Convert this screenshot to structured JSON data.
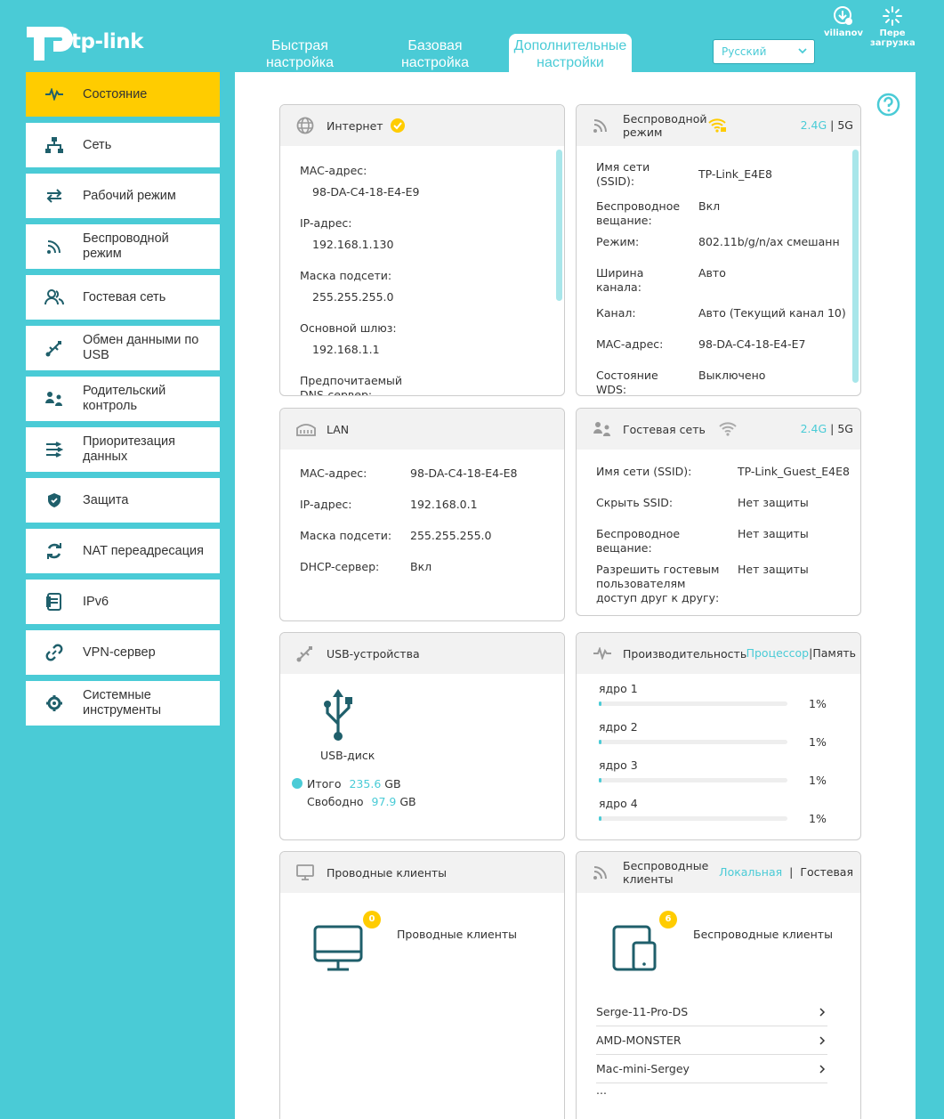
{
  "brand": {
    "name": "tp-link"
  },
  "top_tabs": [
    {
      "label": "Быстрая настройка"
    },
    {
      "label": "Базовая настройка"
    },
    {
      "label": "Дополнительные настройки"
    }
  ],
  "language": {
    "selected": "Русский"
  },
  "user": {
    "name": "vilianov"
  },
  "reboot": {
    "label": "Пере загрузка"
  },
  "sidebar": {
    "items": [
      {
        "label": "Состояние",
        "icon": "pulse-icon"
      },
      {
        "label": "Сеть",
        "icon": "network-icon"
      },
      {
        "label": "Рабочий режим",
        "icon": "mode-icon"
      },
      {
        "label": "Беспроводной режим",
        "icon": "wireless-icon"
      },
      {
        "label": "Гостевая сеть",
        "icon": "guest-icon"
      },
      {
        "label": "Обмен данными по USB",
        "icon": "usb-icon"
      },
      {
        "label": "Родительский контроль",
        "icon": "parental-icon"
      },
      {
        "label": "Приоритезация данных",
        "icon": "qos-icon"
      },
      {
        "label": "Защита",
        "icon": "shield-icon"
      },
      {
        "label": "NAT переадресация",
        "icon": "nat-icon"
      },
      {
        "label": "IPv6",
        "icon": "ipv6-icon"
      },
      {
        "label": "VPN-сервер",
        "icon": "link-icon"
      },
      {
        "label": "Системные инструменты",
        "icon": "gear-icon"
      }
    ]
  },
  "internet": {
    "title": "Интернет",
    "mac_label": "MAC-адрес:",
    "mac": "98-DA-C4-18-E4-E9",
    "ip_label": "IP-адрес:",
    "ip": "192.168.1.130",
    "mask_label": "Маска подсети:",
    "mask": "255.255.255.0",
    "gw_label": "Основной шлюз:",
    "gw": "192.168.1.1",
    "dns_label": "Предпочитаемый DNS-сервер:"
  },
  "wireless": {
    "title": "Беспроводной режим",
    "band_24": "2.4G",
    "band_sep": "|",
    "band_5": "5G",
    "ssid_label": "Имя сети (SSID):",
    "ssid": "TP-Link_E4E8",
    "broadcast_label": "Беспроводное вещание:",
    "broadcast": "Вкл",
    "mode_label": "Режим:",
    "mode": "802.11b/g/n/ax смешанн",
    "width_label": "Ширина канала:",
    "width": "Авто",
    "channel_label": "Канал:",
    "channel": "Авто (Текущий канал 10)",
    "mac_label": "MAC-адрес:",
    "mac": "98-DA-C4-18-E4-E7",
    "wds_label": "Состояние WDS:",
    "wds": "Выключено"
  },
  "lan": {
    "title": "LAN",
    "mac_label": "MAC-адрес:",
    "mac": "98-DA-C4-18-E4-E8",
    "ip_label": "IP-адрес:",
    "ip": "192.168.0.1",
    "mask_label": "Маска подсети:",
    "mask": "255.255.255.0",
    "dhcp_label": "DHCP-сервер:",
    "dhcp": "Вкл"
  },
  "guest": {
    "title": "Гостевая сеть",
    "band_24": "2.4G",
    "band_sep": "|",
    "band_5": "5G",
    "ssid_label": "Имя сети (SSID):",
    "ssid": "TP-Link_Guest_E4E8",
    "hide_label": "Скрыть SSID:",
    "hide": "Нет защиты",
    "broadcast_label": "Беспроводное вещание:",
    "broadcast": "Нет защиты",
    "allow_label": "Разрешить гостевым пользователям доступ друг к другу:",
    "allow": "Нет защиты"
  },
  "usb": {
    "title": "USB-устройства",
    "device": "USB-диск",
    "total_label": "Итого",
    "total_value": "235.6",
    "total_unit": "GB",
    "free_label": "Свободно",
    "free_value": "97.9",
    "free_unit": "GB"
  },
  "performance": {
    "title": "Производительность",
    "tab_cpu": "Процессор",
    "tab_sep": "|",
    "tab_mem": "Память",
    "cores": [
      {
        "label": "ядро 1",
        "value": "1%",
        "fraction": 0.01
      },
      {
        "label": "ядро 2",
        "value": "1%",
        "fraction": 0.01
      },
      {
        "label": "ядро 3",
        "value": "1%",
        "fraction": 0.01
      },
      {
        "label": "ядро 4",
        "value": "1%",
        "fraction": 0.01
      }
    ]
  },
  "wired_clients": {
    "title": "Проводные клиенты",
    "count": "0",
    "label": "Проводные клиенты"
  },
  "wireless_clients": {
    "title": "Беспроводные клиенты",
    "tab_local": "Локальная",
    "tab_sep": "|",
    "tab_guest": "Гостевая",
    "count": "6",
    "label": "Беспроводные клиенты",
    "clients": [
      "Serge-11-Pro-DS",
      "AMD-MONSTER",
      "Mac-mini-Sergey"
    ],
    "more": "..."
  },
  "colors": {
    "accent": "#4acbd6",
    "active": "#ffcc00",
    "icon": "#1f5f6b"
  }
}
